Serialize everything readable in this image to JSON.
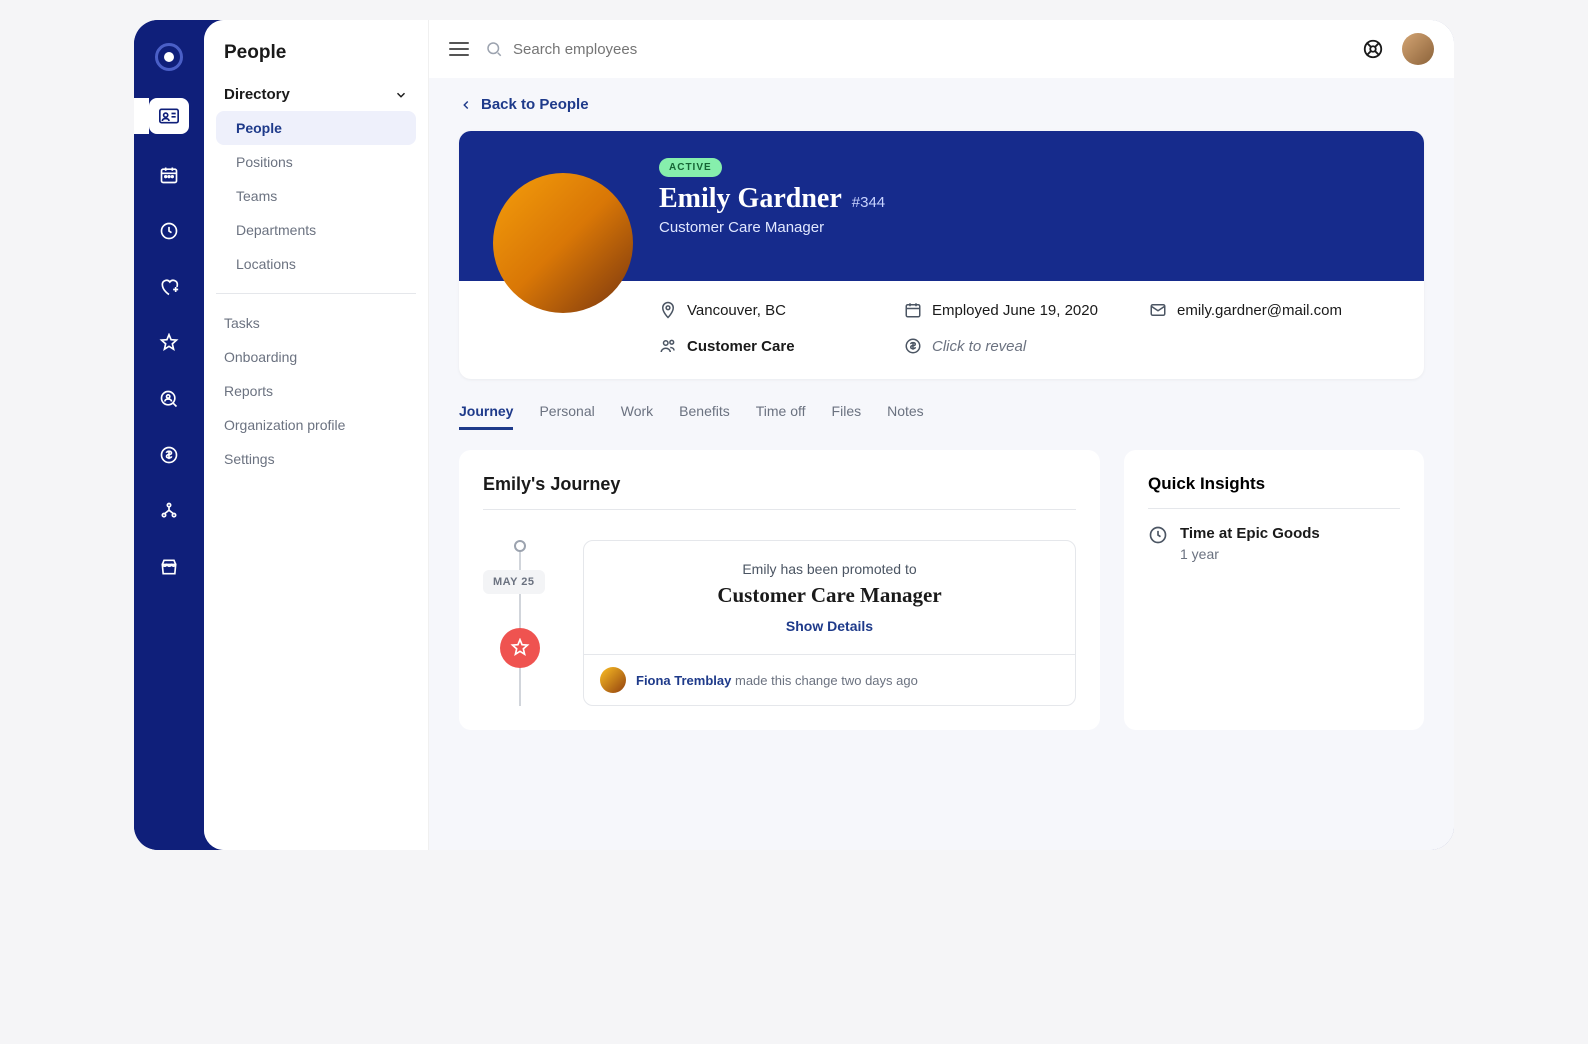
{
  "sidebar": {
    "title": "People",
    "group_header": "Directory",
    "items": [
      "People",
      "Positions",
      "Teams",
      "Departments",
      "Locations"
    ],
    "links": [
      "Tasks",
      "Onboarding",
      "Reports",
      "Organization profile",
      "Settings"
    ]
  },
  "search": {
    "placeholder": "Search employees"
  },
  "back_link": "Back to People",
  "profile": {
    "status": "ACTIVE",
    "name": "Emily Gardner",
    "id": "#344",
    "role": "Customer Care Manager",
    "location": "Vancouver, BC",
    "team": "Customer Care",
    "employed": "Employed June 19, 2020",
    "pay_hidden": "Click to reveal",
    "email": "emily.gardner@mail.com"
  },
  "tabs": [
    "Journey",
    "Personal",
    "Work",
    "Benefits",
    "Time off",
    "Files",
    "Notes"
  ],
  "journey": {
    "title": "Emily's Journey",
    "date": "MAY 25",
    "event_line1": "Emily has been promoted to",
    "event_title": "Customer Care Manager",
    "show_details": "Show Details",
    "author": "Fiona Tremblay",
    "author_suffix": " made this change two days ago"
  },
  "insights": {
    "title": "Quick Insights",
    "label": "Time at Epic Goods",
    "value": "1 year"
  }
}
